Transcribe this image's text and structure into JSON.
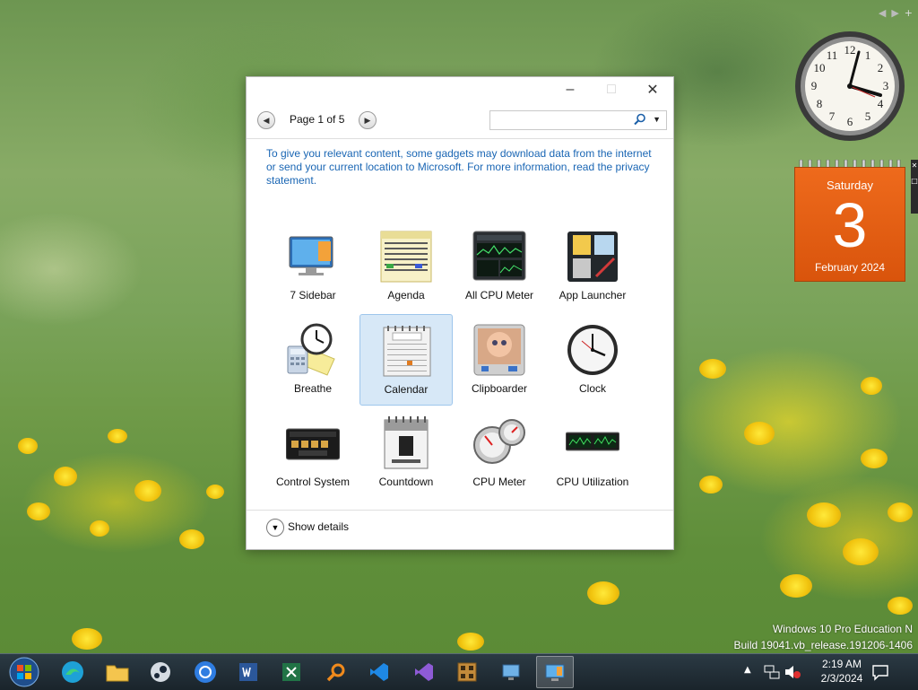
{
  "desktop": {
    "watermark_line1": "Windows 10 Pro Education N",
    "watermark_line2": "Build 19041.vb_release.191206-1406"
  },
  "gadget_gallery": {
    "pager_text": "Page 1 of 5",
    "search_placeholder": "",
    "privacy_text": "To give you relevant content, some gadgets may download data from the internet or send your current location to Microsoft. For more information, read the privacy statement.",
    "gadgets": [
      {
        "label": "7 Sidebar",
        "icon": "sidebar-icon"
      },
      {
        "label": "Agenda",
        "icon": "agenda-icon"
      },
      {
        "label": "All CPU Meter",
        "icon": "cpu-meter-icon"
      },
      {
        "label": "App Launcher",
        "icon": "app-launcher-icon"
      },
      {
        "label": "Breathe",
        "icon": "breathe-icon"
      },
      {
        "label": "Calendar",
        "icon": "calendar-icon",
        "selected": true
      },
      {
        "label": "Clipboarder",
        "icon": "clipboarder-icon"
      },
      {
        "label": "Clock",
        "icon": "clock-icon"
      },
      {
        "label": "Control System",
        "icon": "control-system-icon"
      },
      {
        "label": "Countdown",
        "icon": "countdown-icon"
      },
      {
        "label": "CPU Meter",
        "icon": "cpu-meter-dial-icon"
      },
      {
        "label": "CPU Utilization",
        "icon": "cpu-utilization-icon"
      }
    ],
    "show_details_label": "Show details"
  },
  "calendar_gadget": {
    "weekday": "Saturday",
    "day": "3",
    "month_year": "February 2024"
  },
  "taskbar": {
    "apps": [
      "start",
      "edge",
      "file-explorer",
      "steam",
      "chrome",
      "word",
      "excel",
      "search-tool",
      "vscode",
      "visual-studio",
      "app-8",
      "remote-desktop",
      "gadgets"
    ],
    "time": "2:19 AM",
    "date": "2/3/2024"
  }
}
